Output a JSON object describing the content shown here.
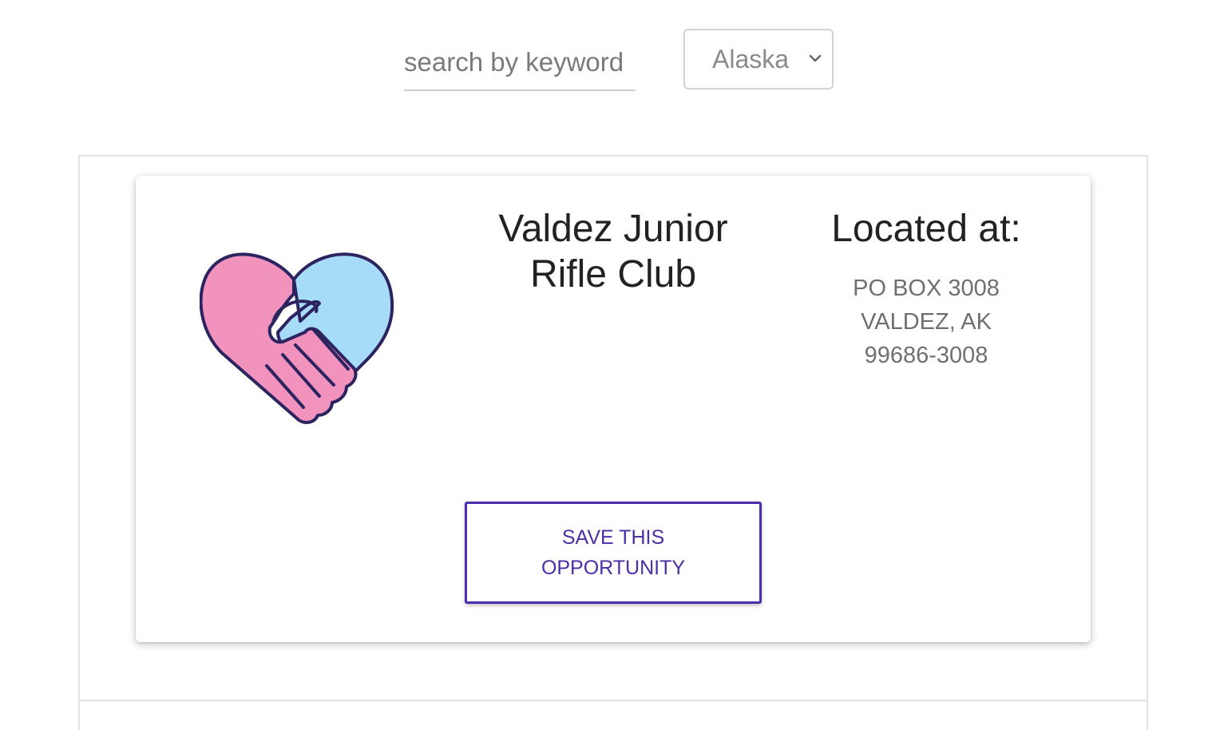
{
  "search": {
    "placeholder": "search by keyword",
    "value": ""
  },
  "state_filter": {
    "selected": "Alaska",
    "icon": "chevron-down-icon"
  },
  "opportunity": {
    "logo_icon": "heart-handshake-icon",
    "name_line1": "Valdez Junior",
    "name_line2": "Rifle Club",
    "location_heading": "Located at:",
    "address_line1": "PO BOX 3008",
    "address_line2": "VALDEZ, AK",
    "address_line3": "99686-3008",
    "save_label_line1": "SAVE THIS",
    "save_label_line2": "OPPORTUNITY"
  },
  "colors": {
    "accent": "#4b2ea8",
    "heart_pink": "#f293bd",
    "heart_blue": "#a6dcf8",
    "outline": "#2c2460"
  }
}
